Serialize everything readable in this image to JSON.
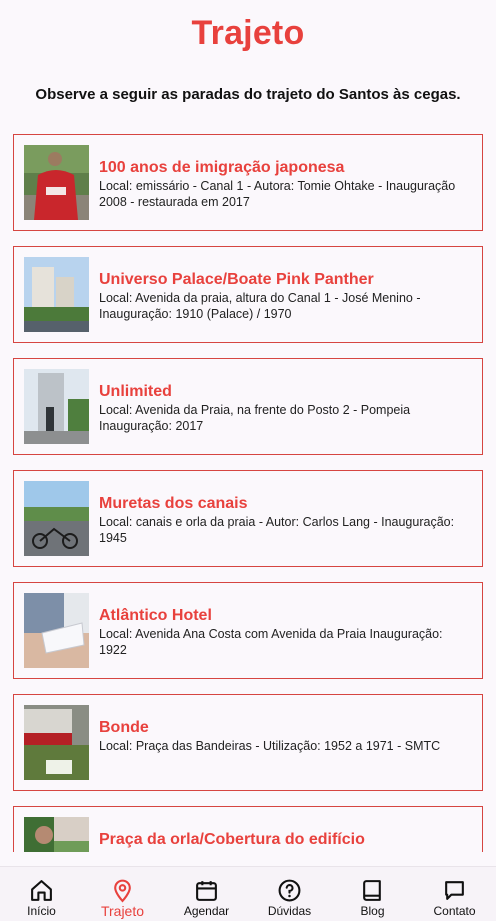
{
  "header": {
    "title": "Trajeto",
    "subtitle": "Observe a seguir as paradas do trajeto do Santos às cegas."
  },
  "stops": [
    {
      "title": "100 anos de imigração japonesa",
      "description": "Local: emissário - Canal 1 - Autora: Tomie Ohtake - Inauguração 2008 - restaurada em 2017"
    },
    {
      "title": "Universo Palace/Boate Pink Panther",
      "description": "Local: Avenida da praia, altura do Canal 1 - José Menino - Inauguração: 1910 (Palace) / 1970"
    },
    {
      "title": "Unlimited",
      "description": "Local: Avenida da Praia, na frente do Posto 2 - Pompeia Inauguração: 2017"
    },
    {
      "title": "Muretas dos canais",
      "description": "Local: canais e orla da praia - Autor: Carlos Lang - Inauguração: 1945"
    },
    {
      "title": "Atlântico Hotel",
      "description": "Local: Avenida Ana Costa com Avenida da Praia Inauguração: 1922"
    },
    {
      "title": "Bonde",
      "description": "Local: Praça das Bandeiras - Utilização: 1952 a 1971 - SMTC"
    },
    {
      "title": "Praça da orla/Cobertura do edifício",
      "description": ""
    }
  ],
  "nav": {
    "home": "Início",
    "route": "Trajeto",
    "schedule": "Agendar",
    "faq": "Dúvidas",
    "blog": "Blog",
    "contact": "Contato"
  },
  "colors": {
    "accent": "#e8413d",
    "card_border": "#d64541",
    "background": "#fbf8fc"
  }
}
